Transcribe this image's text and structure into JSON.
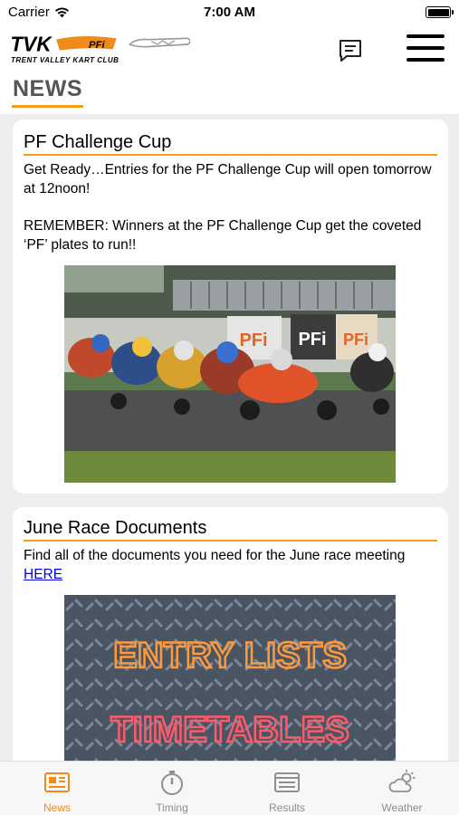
{
  "status_bar": {
    "carrier": "Carrier",
    "time": "7:00 AM"
  },
  "header": {
    "logo_text": "TVK",
    "logo_badge": "PFi",
    "logo_tagline": "TRENT VALLEY KART CLUB",
    "page_title": "NEWS"
  },
  "news": [
    {
      "title": "PF Challenge Cup",
      "paragraph_1": "Get Ready…Entries for the PF Challenge Cup will open tomorrow at 12noon!",
      "paragraph_2": "REMEMBER: Winners at the PF Challenge Cup get the coveted ‘PF’ plates to run!!",
      "image_banner": "PFi"
    },
    {
      "title": "June Race Documents",
      "paragraph_text": "Find all of the documents you need for the June race meeting ",
      "link_text": "HERE",
      "image_line_1": "ENTRY LISTS",
      "image_line_2": "TIIMETABLES"
    }
  ],
  "tabs": [
    {
      "label": "News",
      "icon": "newspaper-icon",
      "active": true
    },
    {
      "label": "Timing",
      "icon": "stopwatch-icon",
      "active": false
    },
    {
      "label": "Results",
      "icon": "results-icon",
      "active": false
    },
    {
      "label": "Weather",
      "icon": "weather-icon",
      "active": false
    }
  ],
  "colors": {
    "accent": "#f08a1a",
    "rule": "#f59c1a",
    "link": "#0000ee",
    "background": "#eeeeee"
  }
}
